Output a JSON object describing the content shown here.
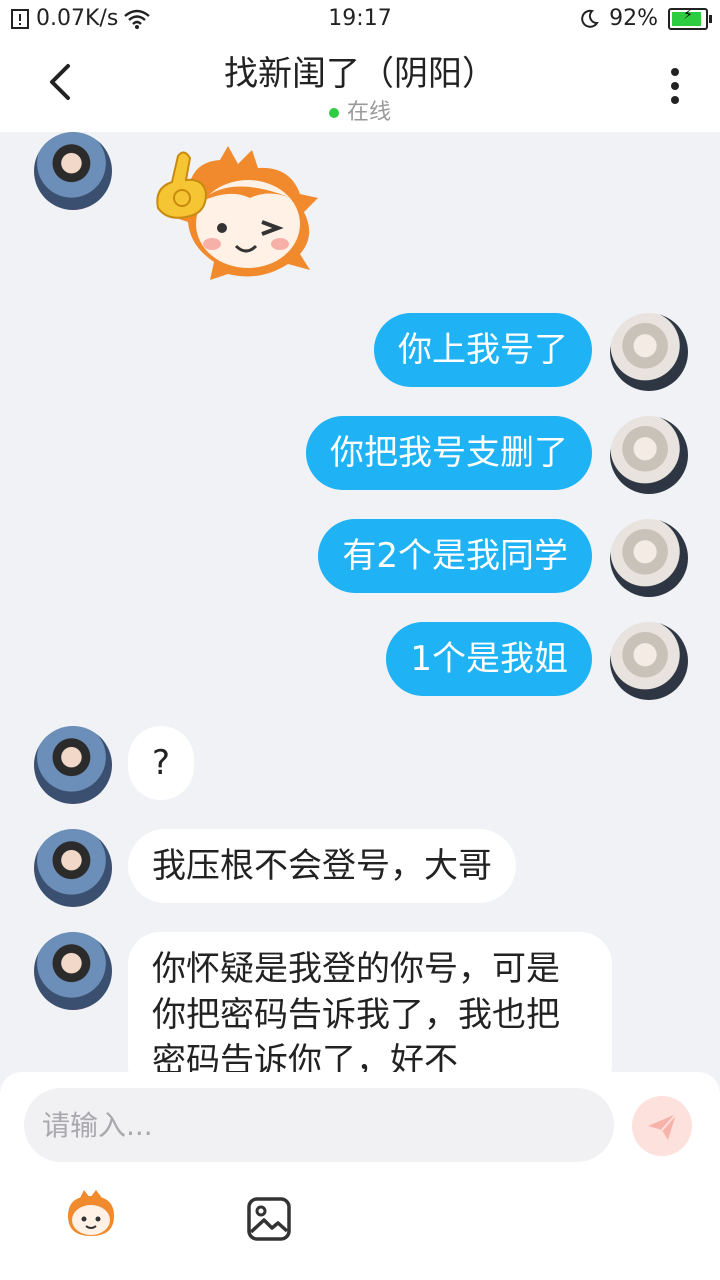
{
  "statusbar": {
    "net_speed": "0.07K/s",
    "time": "19:17",
    "battery_percent": "92%",
    "battery_level": 0.92
  },
  "header": {
    "title": "找新闺了（阴阳）",
    "status": "在线"
  },
  "messages": [
    {
      "side": "in",
      "type": "sticker"
    },
    {
      "side": "out",
      "text": "你上我号了"
    },
    {
      "side": "out",
      "text": "你把我号支删了"
    },
    {
      "side": "out",
      "text": "有2个是我同学"
    },
    {
      "side": "out",
      "text": "1个是我姐"
    },
    {
      "side": "in",
      "text": "?"
    },
    {
      "side": "in",
      "text": "我压根不会登号，大哥"
    },
    {
      "side": "in",
      "text": "你怀疑是我登的你号，可是你把密码告诉我了，我也把密码告诉你了，好不"
    }
  ],
  "composer": {
    "placeholder": "请输入..."
  },
  "colors": {
    "accent": "#1fb2f5",
    "online": "#2ecc40",
    "background": "#f0f2f6"
  },
  "icons": [
    "back-arrow-icon",
    "more-vertical-icon",
    "wifi-icon",
    "moon-icon",
    "send-icon",
    "emoji-icon",
    "image-icon"
  ]
}
